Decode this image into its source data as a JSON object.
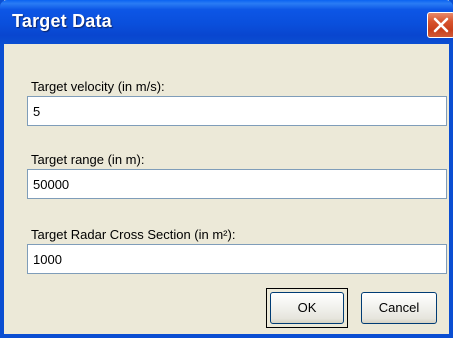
{
  "dialog": {
    "title": "Target Data"
  },
  "fields": [
    {
      "label": "Target velocity (in m/s):",
      "value": "5"
    },
    {
      "label": "Target range (in m):",
      "value": "50000"
    },
    {
      "label": "Target Radar Cross Section (in m²):",
      "value": "1000"
    }
  ],
  "buttons": {
    "ok_label": "OK",
    "cancel_label": "Cancel"
  },
  "icons": {
    "close": "close-icon"
  },
  "colors": {
    "titlebar": "#0a4ed2",
    "close_button": "#d05a38",
    "background": "#ece9d8"
  }
}
